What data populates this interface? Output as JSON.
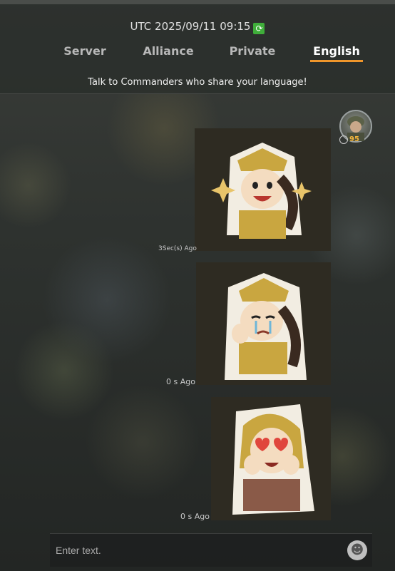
{
  "header": {
    "time": "UTC 2025/09/11 09:15",
    "sync_icon": "sync-icon",
    "tabs": [
      {
        "label": "Server",
        "active": false
      },
      {
        "label": "Alliance",
        "active": false
      },
      {
        "label": "Private",
        "active": false
      },
      {
        "label": "English",
        "active": true
      }
    ],
    "accent_color": "#f0962b",
    "subtitle": "Talk to Commanders who share your language!"
  },
  "sender": {
    "avatar": "soldier-avatar",
    "level": "95"
  },
  "messages": [
    {
      "sticker": "happy-soldier-girl-sticker",
      "time": "3Sec(s) Ago"
    },
    {
      "sticker": "crying-soldier-girl-sticker",
      "time": "0 s Ago"
    },
    {
      "sticker": "heart-eyes-girl-sticker",
      "time": "0 s Ago"
    }
  ],
  "composer": {
    "placeholder": "Enter text.",
    "emoji_icon": "smiley-icon"
  }
}
